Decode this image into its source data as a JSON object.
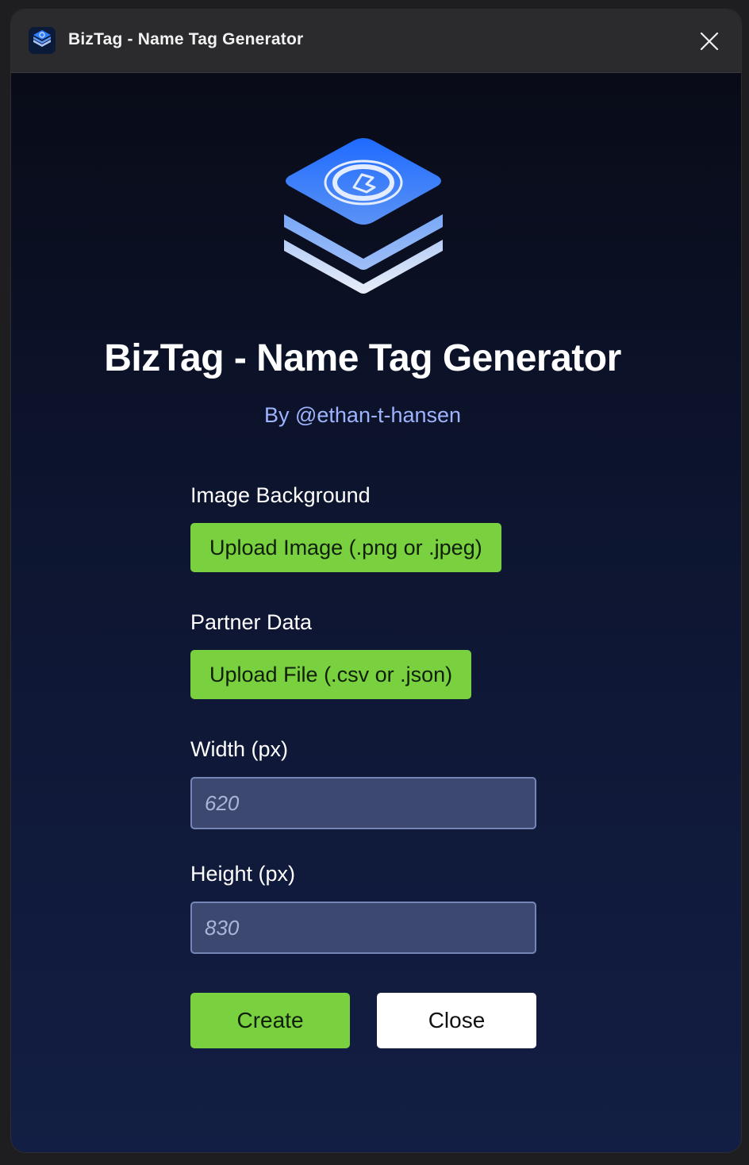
{
  "window": {
    "title": "BizTag - Name Tag Generator",
    "icon": "layers-logo-icon",
    "close_icon": "close-icon"
  },
  "header": {
    "logo": "layers-logo-icon",
    "title": "BizTag - Name Tag Generator",
    "byline": "By @ethan-t-hansen"
  },
  "form": {
    "image_background": {
      "label": "Image Background",
      "button_label": "Upload Image (.png or .jpeg)"
    },
    "partner_data": {
      "label": "Partner Data",
      "button_label": "Upload File (.csv or .json)"
    },
    "width": {
      "label": "Width (px)",
      "placeholder": "620"
    },
    "height": {
      "label": "Height (px)",
      "placeholder": "830"
    }
  },
  "actions": {
    "create_label": "Create",
    "close_label": "Close"
  },
  "colors": {
    "accent_green": "#79d13f",
    "byline_blue": "#9fb4ff",
    "logo_blue": "#2e7bff",
    "input_bg": "#3c4870"
  }
}
